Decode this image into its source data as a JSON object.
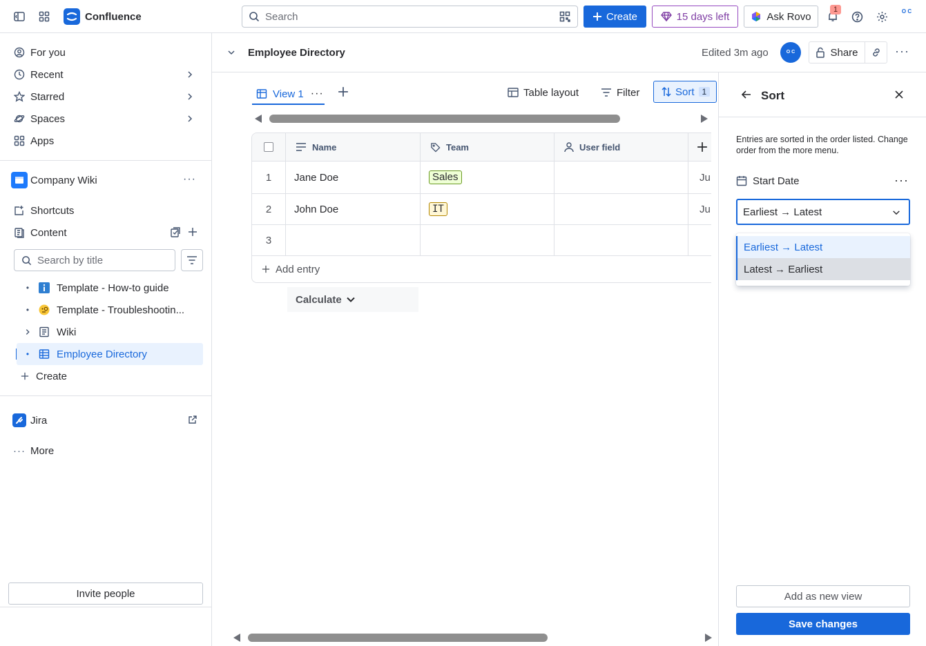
{
  "topbar": {
    "app_name": "Confluence",
    "search_placeholder": "Search",
    "create_label": "Create",
    "trial_label": "15 days left",
    "rovo_label": "Ask Rovo",
    "notification_count": "1",
    "avatar_initials": "O C"
  },
  "sidebar": {
    "nav": [
      {
        "label": "For you"
      },
      {
        "label": "Recent"
      },
      {
        "label": "Starred"
      },
      {
        "label": "Spaces"
      },
      {
        "label": "Apps"
      }
    ],
    "space_name": "Company Wiki",
    "shortcuts_label": "Shortcuts",
    "content_label": "Content",
    "search_placeholder": "Search by title",
    "tree": [
      {
        "label": "Template - How-to guide"
      },
      {
        "label": "Template - Troubleshootin..."
      },
      {
        "label": "Wiki"
      },
      {
        "label": "Employee Directory"
      }
    ],
    "create_label": "Create",
    "jira_label": "Jira",
    "more_label": "More",
    "invite_label": "Invite people"
  },
  "page": {
    "title": "Employee Directory",
    "edited": "Edited 3m ago",
    "avatar_initials": "O C",
    "share_label": "Share"
  },
  "database": {
    "view_label": "View 1",
    "layout_label": "Table layout",
    "filter_label": "Filter",
    "sort_label": "Sort",
    "sort_count": "1",
    "columns": [
      "Name",
      "Team",
      "User field"
    ],
    "rows": [
      {
        "num": "1",
        "name": "Jane Doe",
        "team": "Sales",
        "next": "Ju"
      },
      {
        "num": "2",
        "name": "John Doe",
        "team": "IT",
        "next": "Ju"
      },
      {
        "num": "3",
        "name": "",
        "team": "",
        "next": ""
      }
    ],
    "add_entry_label": "Add entry",
    "calculate_label": "Calculate"
  },
  "sort_panel": {
    "title": "Sort",
    "description": "Entries are sorted in the order listed. Change order from the more menu.",
    "field_label": "Start Date",
    "selected_value": "Earliest → Latest",
    "options": [
      "Earliest → Latest",
      "Latest → Earliest"
    ],
    "add_view_label": "Add as new view",
    "save_label": "Save changes"
  },
  "colors": {
    "brand_blue": "#1868db",
    "trial_purple": "#803fa5",
    "tag_sales_bg": "#efffd6",
    "tag_it_bg": "#fff7d6"
  }
}
